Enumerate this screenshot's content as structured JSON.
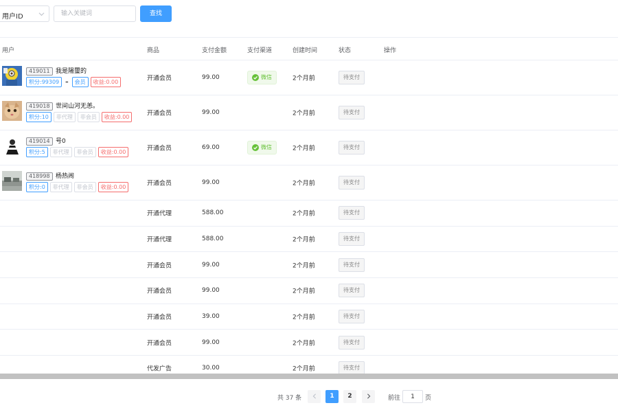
{
  "toolbar": {
    "field_select": "用户ID",
    "keyword_placeholder": "输入关键词",
    "search_label": "查找"
  },
  "table": {
    "headers": {
      "user": "用户",
      "product": "商品",
      "amount": "支付金额",
      "channel": "支付渠道",
      "created": "创建时间",
      "status": "状态",
      "actions": "操作"
    },
    "user_rows": [
      {
        "avatar": "avatar-minion-icon",
        "uid": "419011",
        "name": "我是陽璽的",
        "tags": [
          {
            "text": "积分:99309",
            "style": "blue"
          },
          {
            "text": "–",
            "style": "dash"
          },
          {
            "text": "会员",
            "style": "blue"
          },
          {
            "text": "收益:0.00",
            "style": "red"
          }
        ],
        "product": "开通会员",
        "amount": "99.00",
        "channel": "微信",
        "created": "2个月前",
        "status": "待支付"
      },
      {
        "avatar": "avatar-cat-icon",
        "uid": "419018",
        "name": "世间山河无恙。",
        "tags": [
          {
            "text": "积分:10",
            "style": "blue"
          },
          {
            "text": "非代理",
            "style": "gray"
          },
          {
            "text": "非会员",
            "style": "gray"
          },
          {
            "text": "收益:0.00",
            "style": "red"
          }
        ],
        "product": "开通会员",
        "amount": "99.00",
        "channel": "",
        "created": "2个月前",
        "status": "待支付"
      },
      {
        "avatar": "avatar-person-icon",
        "uid": "419014",
        "name": "号0",
        "tags": [
          {
            "text": "积分:5",
            "style": "blue"
          },
          {
            "text": "非代理",
            "style": "gray"
          },
          {
            "text": "非会员",
            "style": "gray"
          },
          {
            "text": "收益:0.00",
            "style": "red"
          }
        ],
        "product": "开通会员",
        "amount": "69.00",
        "channel": "微信",
        "created": "2个月前",
        "status": "待支付"
      },
      {
        "avatar": "avatar-landscape-icon",
        "uid": "418998",
        "name": "杨热闹",
        "tags": [
          {
            "text": "积分:0",
            "style": "blue"
          },
          {
            "text": "非代理",
            "style": "gray"
          },
          {
            "text": "非会员",
            "style": "gray"
          },
          {
            "text": "收益:0.00",
            "style": "red"
          }
        ],
        "product": "开通会员",
        "amount": "99.00",
        "channel": "",
        "created": "2个月前",
        "status": "待支付"
      }
    ],
    "plain_rows": [
      {
        "product": "开通代理",
        "amount": "588.00",
        "created": "2个月前",
        "status": "待支付"
      },
      {
        "product": "开通代理",
        "amount": "588.00",
        "created": "2个月前",
        "status": "待支付"
      },
      {
        "product": "开通会员",
        "amount": "99.00",
        "created": "2个月前",
        "status": "待支付"
      },
      {
        "product": "开通会员",
        "amount": "99.00",
        "created": "2个月前",
        "status": "待支付"
      },
      {
        "product": "开通会员",
        "amount": "39.00",
        "created": "2个月前",
        "status": "待支付"
      },
      {
        "product": "开通会员",
        "amount": "99.00",
        "created": "2个月前",
        "status": "待支付"
      },
      {
        "product": "代发广告",
        "amount": "30.00",
        "created": "2个月前",
        "status": "待支付"
      }
    ]
  },
  "pagination": {
    "total": "共 37 条",
    "pages": [
      "1",
      "2"
    ],
    "current": "1",
    "goto_label": "前往",
    "goto_value": "1",
    "goto_suffix": "页"
  },
  "colors": {
    "primary": "#409eff",
    "wechat_green": "#67c23a",
    "danger": "#f56c6c"
  }
}
